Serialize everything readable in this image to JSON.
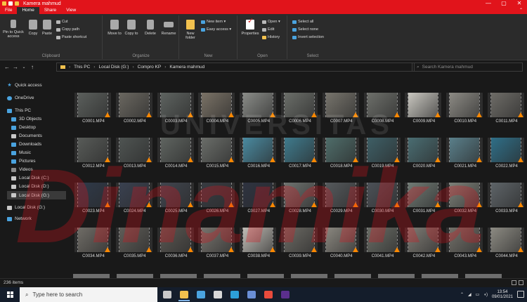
{
  "window": {
    "title": "Kamera mahmud",
    "controls": [
      "—",
      "▢",
      "✕"
    ]
  },
  "tabs": [
    {
      "label": "File",
      "active": false
    },
    {
      "label": "Home",
      "active": true
    },
    {
      "label": "Share",
      "active": false
    },
    {
      "label": "View",
      "active": false
    }
  ],
  "ribbon": {
    "clipboard": {
      "label": "Clipboard",
      "pin": "Pin to Quick access",
      "copy": "Copy",
      "paste": "Paste",
      "cut": "Cut",
      "copy_path": "Copy path",
      "paste_shortcut": "Paste shortcut"
    },
    "organize": {
      "label": "Organize",
      "move_to": "Move to",
      "copy_to": "Copy to",
      "delete": "Delete",
      "rename": "Rename"
    },
    "new": {
      "label": "New",
      "new_folder": "New folder",
      "new_item": "New item ▾",
      "easy_access": "Easy access ▾"
    },
    "open": {
      "label": "Open",
      "properties": "Properties",
      "open": "Open ▾",
      "edit": "Edit",
      "history": "History"
    },
    "select": {
      "label": "Select",
      "select_all": "Select all",
      "select_none": "Select none",
      "invert": "Invert selection"
    }
  },
  "address": {
    "path": [
      "This PC",
      "Local Disk (G:)",
      "Compro KP",
      "Kamera mahmud"
    ],
    "search_placeholder": "Search Kamera mahmud"
  },
  "nav": [
    {
      "label": "Quick access",
      "icon": "star-icon",
      "color": "#4aa3df"
    },
    {
      "label": "OneDrive",
      "icon": "cloud-icon",
      "color": "#4aa3df"
    },
    {
      "label": "This PC",
      "icon": "computer-icon",
      "color": "#4aa3df"
    },
    {
      "label": "3D Objects",
      "icon": "cube-icon",
      "color": "#4aa3df"
    },
    {
      "label": "Desktop",
      "icon": "desktop-icon",
      "color": "#4aa3df"
    },
    {
      "label": "Documents",
      "icon": "document-icon",
      "color": "#c8c8c8"
    },
    {
      "label": "Downloads",
      "icon": "download-icon",
      "color": "#4aa3df"
    },
    {
      "label": "Music",
      "icon": "music-icon",
      "color": "#4aa3df"
    },
    {
      "label": "Pictures",
      "icon": "picture-icon",
      "color": "#4aa3df"
    },
    {
      "label": "Videos",
      "icon": "video-icon",
      "color": "#8a8a8a"
    },
    {
      "label": "Local Disk (C:)",
      "icon": "drive-icon",
      "color": "#c8c8c8"
    },
    {
      "label": "Local Disk (D:)",
      "icon": "drive-icon",
      "color": "#c8c8c8"
    },
    {
      "label": "Local Disk (G:)",
      "icon": "drive-icon",
      "color": "#c8c8c8"
    },
    {
      "label": "Local Disk (G:)",
      "icon": "drive-icon",
      "color": "#c8c8c8"
    },
    {
      "label": "Network",
      "icon": "network-icon",
      "color": "#4aa3df"
    }
  ],
  "files": [
    "C0001.MP4",
    "C0002.MP4",
    "C0003.MP4",
    "C0004.MP4",
    "C0005.MP4",
    "C0006.MP4",
    "C0007.MP4",
    "C0008.MP4",
    "C0009.MP4",
    "C0010.MP4",
    "C0011.MP4",
    "C0012.MP4",
    "C0013.MP4",
    "C0014.MP4",
    "C0015.MP4",
    "C0016.MP4",
    "C0017.MP4",
    "C0018.MP4",
    "C0019.MP4",
    "C0020.MP4",
    "C0021.MP4",
    "C0022.MP4",
    "C0023.MP4",
    "C0024.MP4",
    "C0025.MP4",
    "C0026.MP4",
    "C0027.MP4",
    "C0028.MP4",
    "C0029.MP4",
    "C0030.MP4",
    "C0031.MP4",
    "C0032.MP4",
    "C0033.MP4",
    "C0034.MP4",
    "C0035.MP4",
    "C0036.MP4",
    "C0037.MP4",
    "C0038.MP4",
    "C0039.MP4",
    "C0040.MP4",
    "C0041.MP4",
    "C0042.MP4",
    "C0043.MP4",
    "C0044.MP4"
  ],
  "thumb_colors": [
    "#5b5f5c",
    "#6a6760",
    "#5e6360",
    "#7a7266",
    "#8a8c88",
    "#6b6e69",
    "#77746c",
    "#6d6f6a",
    "#c9c7c0",
    "#8c8a84",
    "#6e6c67",
    "#585b58",
    "#4f5452",
    "#5f6460",
    "#6a6d69",
    "#4a8aa0",
    "#3f7b8d",
    "#4f6d6a",
    "#3e5f66",
    "#4a6d72",
    "#5a7f8a",
    "#2f6f88",
    "#2f3a4a",
    "#3a4150",
    "#40454e",
    "#383c42",
    "#2e3340",
    "#6e726f",
    "#55595c",
    "#4c5157",
    "#707a74",
    "#7c8078",
    "#5e6468",
    "#6f6c66",
    "#5f5d58",
    "#5a5752",
    "#76736d",
    "#c0bdb6",
    "#6c6a64",
    "#8a877f",
    "#6a6d66",
    "#7e7b74",
    "#727069",
    "#8c8a82"
  ],
  "status": {
    "count": "236 items"
  },
  "watermark": {
    "line1": "UNIVERSITAS",
    "line2": "Dinamika"
  },
  "taskbar": {
    "search_placeholder": "Type here to search",
    "time": "13:54",
    "date": "09/01/2021",
    "apps": [
      {
        "icon": "task-view-icon",
        "color": "#c8c8c8"
      },
      {
        "icon": "file-explorer-icon",
        "color": "#f2c14e"
      },
      {
        "icon": "mail-icon",
        "color": "#4aa3df"
      },
      {
        "icon": "store-icon",
        "color": "#d8d8d8"
      },
      {
        "icon": "edge-icon",
        "color": "#2d9fd8"
      },
      {
        "icon": "settings-icon",
        "color": "#6a8fd6"
      },
      {
        "icon": "chrome-icon",
        "color": "#e84b3c"
      },
      {
        "icon": "premiere-icon",
        "color": "#5b2f8e"
      }
    ]
  }
}
